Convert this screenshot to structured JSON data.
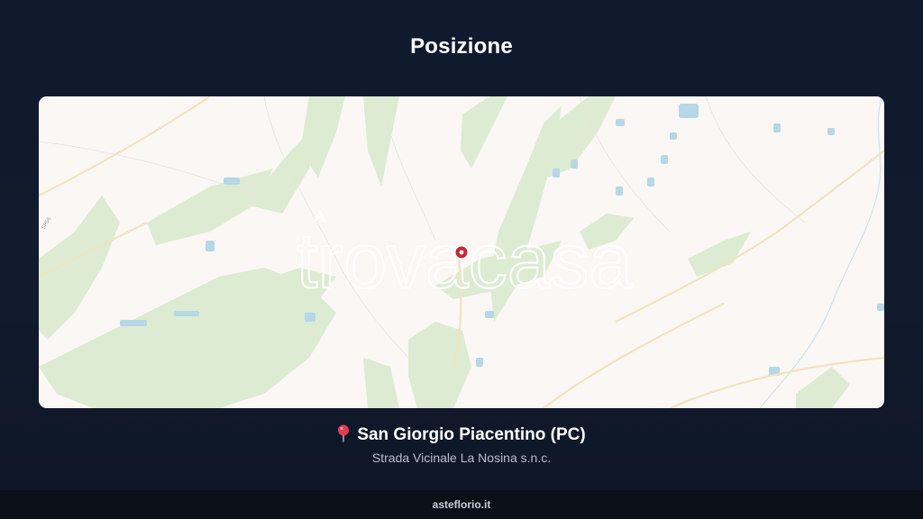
{
  "page": {
    "title": "Posizione"
  },
  "map": {
    "watermark": "trovacasa",
    "road_label": "SP56",
    "marker": "location-marker",
    "colors": {
      "background": "#fbf7f4",
      "vegetation": "#dcebd2",
      "water": "#b6d7e6",
      "road": "#f1e3bf",
      "marker": "#c62a36"
    }
  },
  "location": {
    "pin_icon": "map-pin-icon",
    "name": "San Giorgio Piacentino (PC)",
    "address": "Strada Vicinale La Nosina s.n.c."
  },
  "footer": {
    "site": "asteflorio.it"
  }
}
